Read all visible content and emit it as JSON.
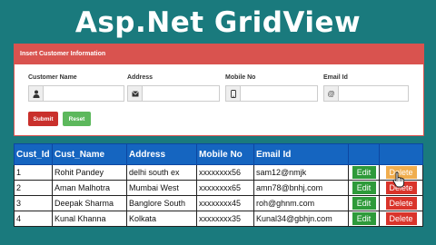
{
  "banner": {
    "title": "Asp.Net GridView"
  },
  "form": {
    "heading": "Insert Customer Information",
    "fields": [
      {
        "label": "Customer Name",
        "icon": "user-icon",
        "value": "",
        "placeholder": ""
      },
      {
        "label": "Address",
        "icon": "envelope-icon",
        "value": "",
        "placeholder": ""
      },
      {
        "label": "Mobile No",
        "icon": "mobile-icon",
        "value": "",
        "placeholder": ""
      },
      {
        "label": "Email Id",
        "icon": "at-icon",
        "value": "",
        "placeholder": ""
      }
    ],
    "email_addon": "@",
    "submit_label": "Submit",
    "reset_label": "Reset"
  },
  "grid": {
    "columns": [
      "Cust_Id",
      "Cust_Name",
      "Address",
      "Mobile No",
      "Email Id",
      "",
      ""
    ],
    "rows": [
      {
        "id": "1",
        "name": "Rohit Pandey",
        "address": "delhi south ex",
        "mobile": "xxxxxxxx56",
        "email": "sam12@nmjk",
        "edit": "Edit",
        "delete": "Delete"
      },
      {
        "id": "2",
        "name": "Aman Malhotra",
        "address": "Mumbai West",
        "mobile": "xxxxxxxx65",
        "email": "amn78@bnhj.com",
        "edit": "Edit",
        "delete": "Delete"
      },
      {
        "id": "3",
        "name": "Deepak Sharma",
        "address": "Banglore South",
        "mobile": "xxxxxxxx45",
        "email": "roh@ghnm.com",
        "edit": "Edit",
        "delete": "Delete"
      },
      {
        "id": "4",
        "name": "Kunal Khanna",
        "address": "Kolkata",
        "mobile": "xxxxxxxx35",
        "email": "Kunal34@gbhjn.com",
        "edit": "Edit",
        "delete": "Delete"
      }
    ]
  },
  "colors": {
    "background": "#1a7a7d",
    "panel_heading": "#d9534f",
    "grid_header": "#1565c0",
    "edit_button": "#2e9a3a",
    "delete_button": "#d9342b",
    "delete_hover": "#f0ad4e"
  }
}
